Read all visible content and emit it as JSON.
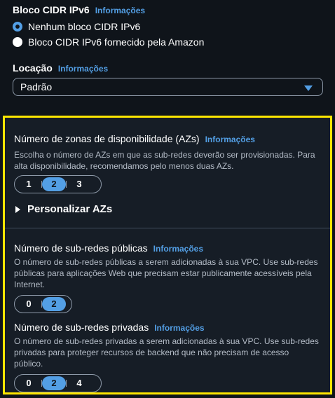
{
  "ipv6": {
    "label": "Bloco CIDR IPv6",
    "info": "Informações",
    "options": [
      {
        "label": "Nenhum bloco CIDR IPv6",
        "selected": true
      },
      {
        "label": "Bloco CIDR IPv6 fornecido pela Amazon",
        "selected": false
      }
    ]
  },
  "tenancy": {
    "label": "Locação",
    "info": "Informações",
    "value": "Padrão"
  },
  "azs": {
    "label": "Número de zonas de disponibilidade (AZs)",
    "info": "Informações",
    "desc_line1": "Escolha o número de AZs em que as sub-redes deverão ser provisionadas. Para",
    "desc_line2": "alta disponibilidade, recomendamos pelo menos duas AZs.",
    "options": [
      "1",
      "2",
      "3"
    ],
    "selected": "2",
    "customize": "Personalizar AZs"
  },
  "public_subnets": {
    "label": "Número de sub-redes públicas",
    "info": "Informações",
    "desc_line1": "O número de sub-redes públicas a serem adicionadas à sua VPC. Use sub-redes",
    "desc_line2": "públicas para aplicações Web que precisam estar publicamente acessíveis pela",
    "desc_line3": "Internet.",
    "options": [
      "0",
      "2"
    ],
    "selected": "2"
  },
  "private_subnets": {
    "label": "Número de sub-redes privadas",
    "info": "Informações",
    "desc_line1": "O número de sub-redes privadas a serem adicionadas à sua VPC. Use sub-redes",
    "desc_line2": "privadas para proteger recursos de backend que não precisam de acesso",
    "desc_line3": "público.",
    "options": [
      "0",
      "2",
      "4"
    ],
    "selected": "2"
  },
  "colors": {
    "accent": "#539fe5",
    "highlight_border": "#ffe600",
    "background": "#0f141a"
  }
}
